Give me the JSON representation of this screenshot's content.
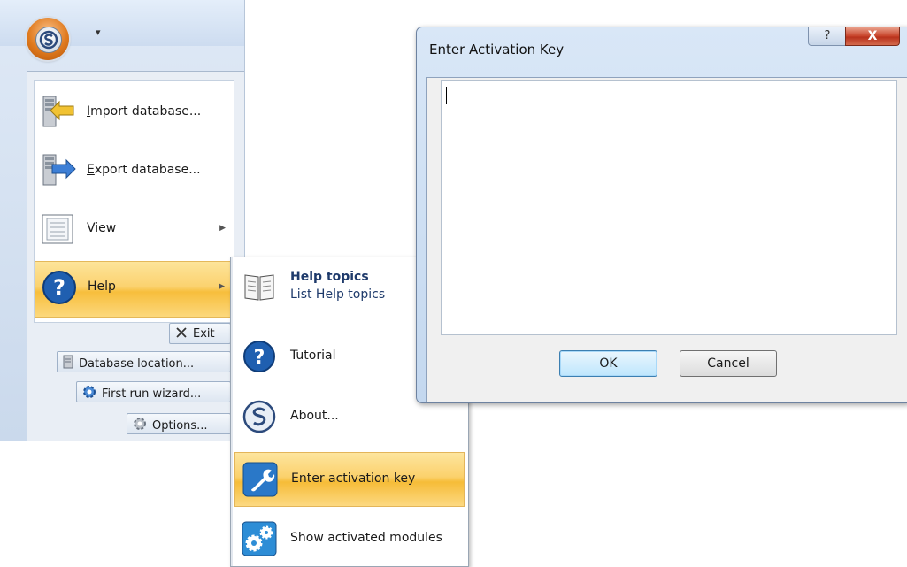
{
  "app": {
    "qat_glyph": "▾",
    "menu_items": [
      {
        "label": "Import database...",
        "icon": "import-database-icon"
      },
      {
        "label": "Export database...",
        "icon": "export-database-icon"
      },
      {
        "label": "View",
        "icon": "view-icon"
      },
      {
        "label": "Help",
        "icon": "help-icon"
      }
    ],
    "buttons": {
      "exit": "Exit",
      "database_location": "Database location...",
      "first_run_wizard": "First run wizard...",
      "options": "Options..."
    }
  },
  "submenu": {
    "help_topics": {
      "title": "Help topics",
      "subtitle": "List Help topics"
    },
    "tutorial": "Tutorial",
    "about": "About...",
    "enter_activation_key": "Enter activation key",
    "show_activated_modules": "Show activated modules"
  },
  "dialog": {
    "title": "Enter Activation Key",
    "help_glyph": "?",
    "close_glyph": "X",
    "input_value": "",
    "ok": "OK",
    "cancel": "Cancel"
  },
  "colors": {
    "highlight": "#fbd26f",
    "accent_blue": "#1f5fb0",
    "orb_orange": "#e07a1e",
    "close_red": "#c7432a"
  }
}
